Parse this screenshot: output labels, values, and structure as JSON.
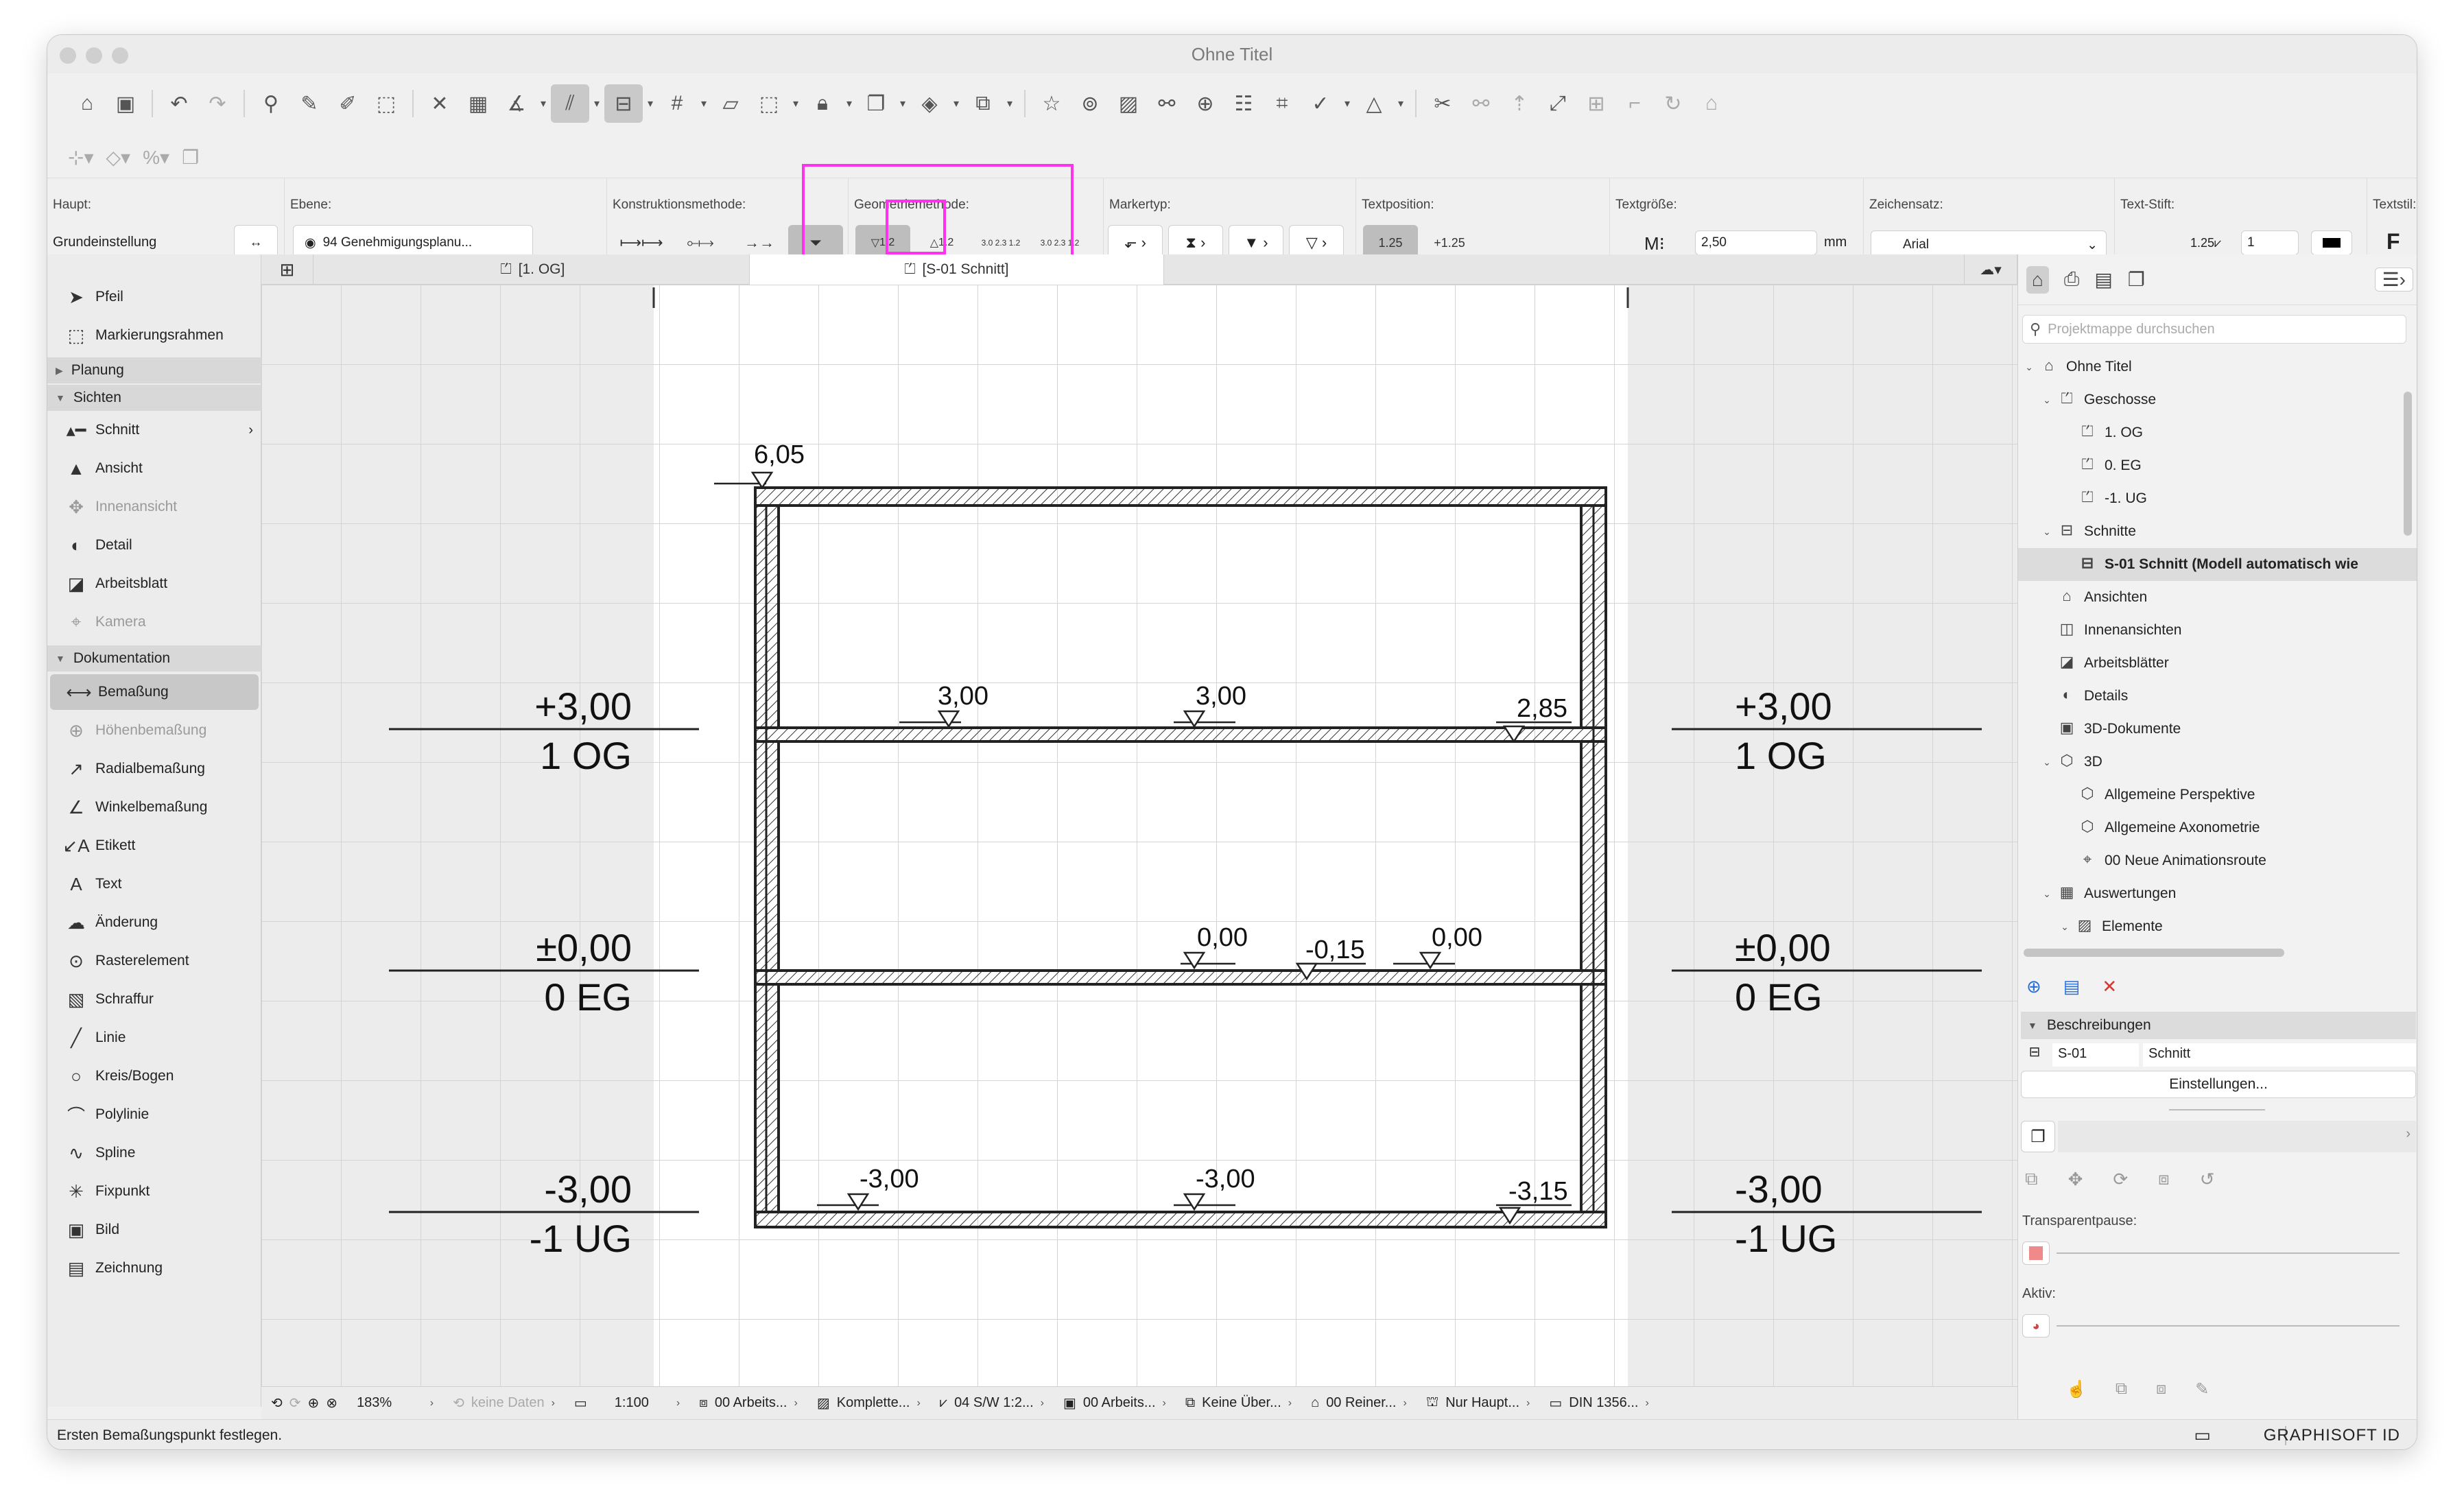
{
  "window": {
    "title": "Ohne Titel"
  },
  "infobox": {
    "haupt": {
      "label": "Haupt:",
      "value": "Grundeinstellung"
    },
    "ebene": {
      "label": "Ebene:",
      "value": "94 Genehmigungsplanu..."
    },
    "konstruktion": {
      "label": "Konstruktionsmethode:"
    },
    "geometrie": {
      "label": "Geometriemethode:",
      "opt1": "1.2",
      "opt2": "1.2",
      "opt3": "3.0 2.3 1.2",
      "opt4": "3.0 2.3 1.2"
    },
    "marker": {
      "label": "Markertyp:"
    },
    "textpos": {
      "label": "Textposition:",
      "opt1": "1.25",
      "opt2": "+1.25"
    },
    "textsize": {
      "label": "Textgröße:",
      "value": "2,50",
      "unit": "mm"
    },
    "charset": {
      "label": "Zeichensatz:",
      "value": "Arial"
    },
    "textpen": {
      "label": "Text-Stift:",
      "value": "1",
      "prefix": "1.25"
    },
    "textstyle": {
      "label": "Textstil:",
      "value": "F"
    }
  },
  "palette": {
    "pfeil": "Pfeil",
    "marquee": "Markierungsrahmen",
    "planung": "Planung",
    "sichten": "Sichten",
    "schnitt": "Schnitt",
    "ansicht": "Ansicht",
    "innenansicht": "Innenansicht",
    "detail": "Detail",
    "arbeitsblatt": "Arbeitsblatt",
    "kamera": "Kamera",
    "dokumentation": "Dokumentation",
    "bemassung": "Bemaßung",
    "hoehenbemassung": "Höhenbemaßung",
    "radialbemassung": "Radialbemaßung",
    "winkelbemassung": "Winkelbemaßung",
    "etikett": "Etikett",
    "text": "Text",
    "aenderung": "Änderung",
    "rasterelement": "Rasterelement",
    "schraffur": "Schraffur",
    "linie": "Linie",
    "kreis": "Kreis/Bogen",
    "polylinie": "Polylinie",
    "spline": "Spline",
    "fixpunkt": "Fixpunkt",
    "bild": "Bild",
    "zeichnung": "Zeichnung"
  },
  "tabs": {
    "tab1": "[1. OG]",
    "tab2": "[S-01 Schnitt]"
  },
  "drawing": {
    "left_levels": [
      {
        "value": "+3,00",
        "name": "1 OG"
      },
      {
        "value": "±0,00",
        "name": "0 EG"
      },
      {
        "value": "-3,00",
        "name": "-1 UG"
      }
    ],
    "right_levels": [
      {
        "value": "+3,00",
        "name": "1 OG"
      },
      {
        "value": "±0,00",
        "name": "0 EG"
      },
      {
        "value": "-3,00",
        "name": "-1 UG"
      }
    ],
    "elevations": [
      "6,05",
      "3,00",
      "3,00",
      "2,85",
      "0,00",
      "-0,15",
      "0,00",
      "-3,00",
      "-3,00",
      "-3,15"
    ]
  },
  "navigator": {
    "search_placeholder": "Projektmappe durchsuchen",
    "items": [
      "Ohne Titel",
      "Geschosse",
      "1. OG",
      "0. EG",
      "-1. UG",
      "Schnitte",
      "S-01 Schnitt (Modell automatisch wie",
      "Ansichten",
      "Innenansichten",
      "Arbeitsblätter",
      "Details",
      "3D-Dokumente",
      "3D",
      "Allgemeine Perspektive",
      "Allgemeine Axonometrie",
      "00 Neue Animationsroute",
      "Auswertungen",
      "Elemente"
    ],
    "beschreibungen": "Beschreibungen",
    "id": "S-01",
    "name": "Schnitt",
    "einstellungen": "Einstellungen...",
    "transparent": "Transparentpause:",
    "aktiv": "Aktiv:"
  },
  "quickbar": {
    "zoom": "183%",
    "keine_daten": "keine Daten",
    "scale": "1:100",
    "layer": "00 Arbeits...",
    "model": "Komplette...",
    "pen": "04 S/W 1:2...",
    "layer2": "00 Arbeits...",
    "override": "Keine Über...",
    "reno": "00 Reiner...",
    "struct": "Nur Haupt...",
    "dim": "DIN 1356..."
  },
  "status": {
    "text": "Ersten Bemaßungspunkt festlegen.",
    "brand": "GRAPHISOFT ID"
  },
  "colors": {
    "highlight": "#ff33ee"
  }
}
